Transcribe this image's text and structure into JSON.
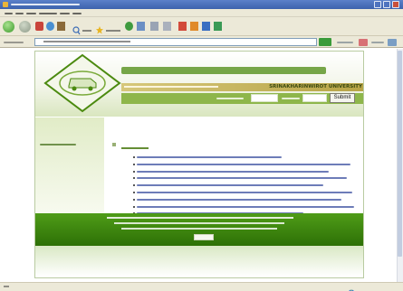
{
  "browser": {
    "menu_count": 6,
    "address_placeholder_width": 96
  },
  "site": {
    "university": "SRINAKHARINWIROT UNIVERSITY",
    "submit_label": "Submit",
    "bullet_count": 15
  },
  "colors": {
    "brand_green": "#4b8a0f",
    "footer_green": "#2d7006",
    "gold": "#d6c77a",
    "link_blue": "#3c50a0"
  },
  "icons": [
    "back-icon",
    "forward-icon",
    "stop-icon",
    "refresh-icon",
    "home-icon",
    "search-icon",
    "favorites-icon",
    "history-icon",
    "mail-icon",
    "print-icon",
    "go-icon",
    "internet-zone-icon"
  ]
}
